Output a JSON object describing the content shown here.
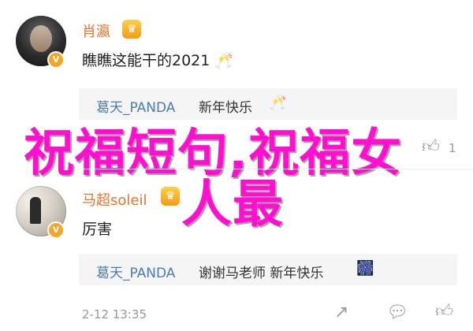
{
  "comment1": {
    "username": "肖瀛",
    "text": "瞧瞧这能干的2021",
    "text_emoji": "🥂",
    "reply": {
      "user": "葛天_PANDA",
      "text": "新年快乐",
      "emoji": "🥂"
    }
  },
  "comment2": {
    "username": "马超soleil",
    "text": "厉害",
    "reply": {
      "user": "葛天_PANDA",
      "text": "谢谢马老师 新年快乐",
      "emoji": "🎆"
    },
    "timestamp": "2-12 13:35"
  },
  "actions": {
    "count": "1"
  },
  "overlay": {
    "line1": "祝福短句,祝福女",
    "line2": "人最"
  }
}
